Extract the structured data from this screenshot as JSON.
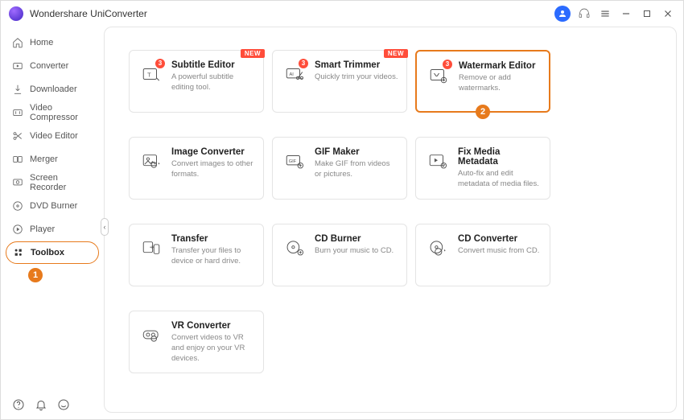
{
  "app": {
    "title": "Wondershare UniConverter"
  },
  "sidebar": {
    "items": [
      {
        "label": "Home"
      },
      {
        "label": "Converter"
      },
      {
        "label": "Downloader"
      },
      {
        "label": "Video Compressor"
      },
      {
        "label": "Video Editor"
      },
      {
        "label": "Merger"
      },
      {
        "label": "Screen Recorder"
      },
      {
        "label": "DVD Burner"
      },
      {
        "label": "Player"
      },
      {
        "label": "Toolbox"
      }
    ],
    "active_index": 9
  },
  "callouts": {
    "one": "1",
    "two": "2"
  },
  "badges": {
    "new": "NEW",
    "count3": "3"
  },
  "tools": [
    {
      "title": "Subtitle Editor",
      "desc": "A powerful subtitle editing tool.",
      "new": true,
      "badge3": true
    },
    {
      "title": "Smart Trimmer",
      "desc": "Quickly trim your videos.",
      "new": true,
      "badge3": true
    },
    {
      "title": "Watermark Editor",
      "desc": "Remove or add watermarks.",
      "new": false,
      "badge3": true,
      "highlight": true
    },
    {
      "title": "Image Converter",
      "desc": "Convert images to other formats.",
      "new": false,
      "badge3": false
    },
    {
      "title": "GIF Maker",
      "desc": "Make GIF from videos or pictures.",
      "new": false,
      "badge3": false
    },
    {
      "title": "Fix Media Metadata",
      "desc": "Auto-fix and edit metadata of media files.",
      "new": false,
      "badge3": false
    },
    {
      "title": "Transfer",
      "desc": "Transfer your files to device or hard drive.",
      "new": false,
      "badge3": false
    },
    {
      "title": "CD Burner",
      "desc": "Burn your music to CD.",
      "new": false,
      "badge3": false
    },
    {
      "title": "CD Converter",
      "desc": "Convert music from CD.",
      "new": false,
      "badge3": false
    },
    {
      "title": "VR Converter",
      "desc": "Convert videos to VR and enjoy on your VR devices.",
      "new": false,
      "badge3": false
    }
  ]
}
